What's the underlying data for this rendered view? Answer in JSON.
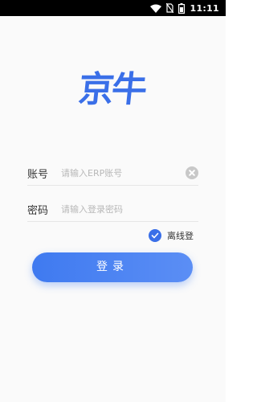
{
  "status_bar": {
    "time": "11:11",
    "icons": [
      "wifi-icon",
      "no-sim-icon",
      "battery-icon"
    ]
  },
  "logo": {
    "text": "京牛",
    "color": "#3a6fe8"
  },
  "form": {
    "account": {
      "label": "账号",
      "placeholder": "请输入ERP账号",
      "value": ""
    },
    "password": {
      "label": "密码",
      "placeholder": "请输入登录密码",
      "value": ""
    },
    "offline_login": {
      "label": "离线登",
      "checked": true
    },
    "login_button": {
      "label": "登录"
    }
  },
  "colors": {
    "accent": "#3a6fe8",
    "background": "#fafafa"
  }
}
